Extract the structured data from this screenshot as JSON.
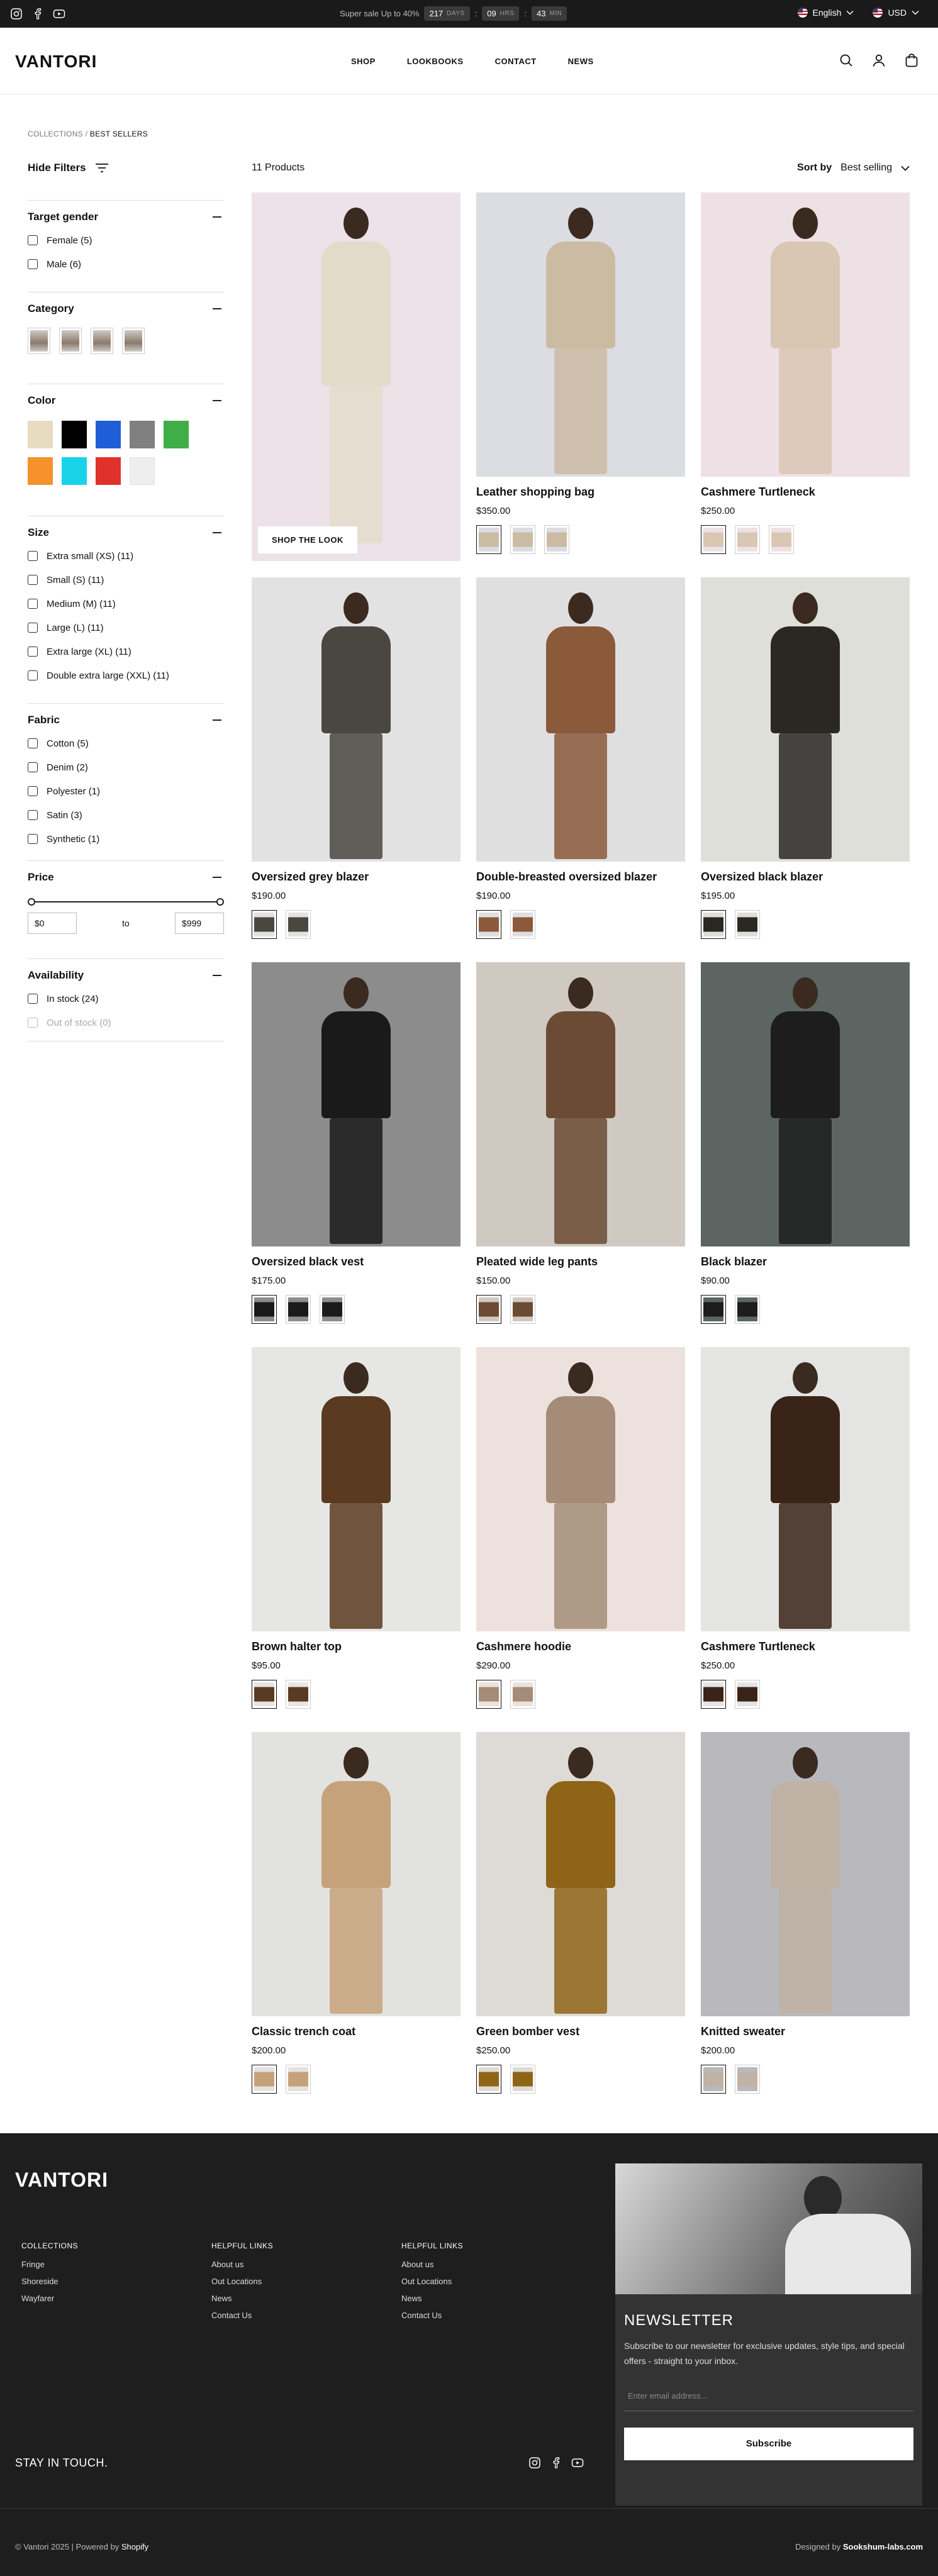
{
  "topbar": {
    "announcement": "Super sale Up to 40%",
    "countdown": [
      {
        "value": "217",
        "unit": "DAYS"
      },
      {
        "value": "09",
        "unit": "HRS"
      },
      {
        "value": "43",
        "unit": "MIN"
      }
    ],
    "language": "English",
    "currency": "USD",
    "socials": [
      "instagram-icon",
      "facebook-icon",
      "youtube-icon"
    ]
  },
  "header": {
    "logo": "VANTORI",
    "nav": [
      "SHOP",
      "LOOKBOOKS",
      "CONTACT",
      "NEWS"
    ],
    "icons": [
      "search-icon",
      "account-icon",
      "cart-icon"
    ]
  },
  "breadcrumb": {
    "parent": "COLLECTIONS",
    "separator": " / ",
    "current": "BEST SELLERS"
  },
  "filters": {
    "toggle_label": "Hide Filters",
    "gender": {
      "title": "Target gender",
      "options": [
        "Female (5)",
        "Male (6)"
      ]
    },
    "category": {
      "title": "Category"
    },
    "color": {
      "title": "Color",
      "swatches": [
        "#e8dcc0",
        "#000000",
        "#1e5fd6",
        "#808080",
        "#3fae46",
        "#f5922b",
        "#19d3ea",
        "#e0312a",
        "#eeeeee"
      ]
    },
    "size": {
      "title": "Size",
      "options": [
        "Extra small (XS) (11)",
        "Small (S) (11)",
        "Medium (M) (11)",
        "Large (L) (11)",
        "Extra large (XL) (11)",
        "Double extra large (XXL) (11)"
      ]
    },
    "fabric": {
      "title": "Fabric",
      "options": [
        "Cotton (5)",
        "Denim (2)",
        "Polyester (1)",
        "Satin (3)",
        "Synthetic (1)"
      ]
    },
    "price": {
      "title": "Price",
      "min": "$0",
      "to": "to",
      "max": "$999"
    },
    "availability": {
      "title": "Availability",
      "options": [
        "In stock (24)",
        "Out of stock (0)"
      ]
    }
  },
  "listing": {
    "count": "11 Products",
    "sort_label": "Sort by",
    "sort_value": "Best selling",
    "shop_look": "SHOP THE LOOK"
  },
  "products": [
    {
      "title": "Leather shopping bag",
      "price": "$350.00",
      "bg": "#dcdde3",
      "tone": "#cbbba3",
      "thumbs": 3
    },
    {
      "title": "Cashmere Turtleneck",
      "price": "$250.00",
      "bg": "#eee1e6",
      "tone": "#d9c6b3",
      "thumbs": 3
    },
    {
      "title": "Oversized grey blazer",
      "price": "$190.00",
      "bg": "#e2e2e2",
      "tone": "#4a4741",
      "thumbs": 2
    },
    {
      "title": "Double-breasted oversized blazer",
      "price": "$190.00",
      "bg": "#e0dfe0",
      "tone": "#8a5a3a",
      "thumbs": 2
    },
    {
      "title": "Oversized black blazer",
      "price": "$195.00",
      "bg": "#dedfd9",
      "tone": "#2b2723",
      "thumbs": 2
    },
    {
      "title": "Oversized black vest",
      "price": "$175.00",
      "bg": "#8c8c8c",
      "tone": "#1a1a1a",
      "thumbs": 3
    },
    {
      "title": "Pleated wide leg pants",
      "price": "$150.00",
      "bg": "#cfc9c2",
      "tone": "#6b4b33",
      "thumbs": 2
    },
    {
      "title": "Black blazer",
      "price": "$90.00",
      "bg": "#5d6563",
      "tone": "#1d1d1d",
      "thumbs": 2
    },
    {
      "title": "Brown halter top",
      "price": "$95.00",
      "bg": "#e6e6e4",
      "tone": "#5a3a20",
      "thumbs": 2
    },
    {
      "title": "Cashmere hoodie",
      "price": "$290.00",
      "bg": "#ece1dc",
      "tone": "#a48c78",
      "thumbs": 2
    },
    {
      "title": "Cashmere Turtleneck",
      "price": "$250.00",
      "bg": "#e4e4e2",
      "tone": "#3a2318",
      "thumbs": 2
    },
    {
      "title": "Classic trench coat",
      "price": "$200.00",
      "bg": "#e2e2e0",
      "tone": "#c6a27a",
      "thumbs": 2
    },
    {
      "title": "Green bomber vest",
      "price": "$250.00",
      "bg": "#dedbd6",
      "tone": "#8f6417",
      "thumbs": 2
    },
    {
      "title": "Knitted sweater",
      "price": "$200.00",
      "bg": "#b9b9bd",
      "tone": "#c0b2a4",
      "thumbs": 2
    }
  ],
  "footer": {
    "logo": "VANTORI",
    "collections": {
      "title": "COLLECTIONS",
      "links": [
        "Fringe",
        "Shoreside",
        "Wayfarer"
      ]
    },
    "helpful1": {
      "title": "HELPFUL LINKS",
      "links": [
        "About us",
        "Out Locations",
        "News",
        "Contact Us"
      ]
    },
    "helpful2": {
      "title": "HELPFUL LINKS",
      "links": [
        "About us",
        "Out Locations",
        "News",
        "Contact Us"
      ]
    },
    "stay": "STAY IN TOUCH.",
    "newsletter_title": "NEWSLETTER",
    "newsletter_text": "Subscribe to our newsletter for exclusive updates, style tips, and special offers - straight to your inbox.",
    "email_placeholder": "Enter email address...",
    "subscribe": "Subscribe",
    "copyright_prefix": "© Vantori 2025 | Powered by ",
    "copyright_brand": "Shopify",
    "designed_prefix": "Designed by ",
    "designed_brand": "Sookshum-labs.com"
  }
}
